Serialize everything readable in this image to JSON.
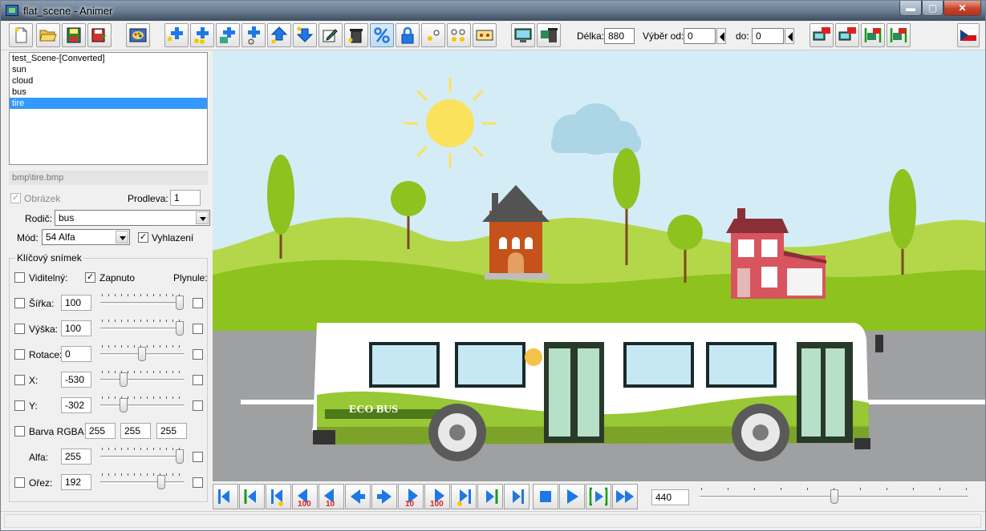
{
  "window": {
    "title": "flat_scene - Animer",
    "close_glyph": "✕",
    "min_glyph": "▬",
    "max_glyph": "▢"
  },
  "toolbar": {
    "length_label": "Délka:",
    "length_value": "880",
    "selection_from_label": "Výběr od:",
    "selection_from_value": "0",
    "selection_to_label": "do:",
    "selection_to_value": "0"
  },
  "objects": [
    "test_Scene-[Converted]",
    "sun",
    "cloud",
    "bus",
    "tire"
  ],
  "selected_object": "tire",
  "image_path": "bmp\\tire.bmp",
  "props": {
    "image_label": "Obrázek",
    "image_checked": true,
    "delay_label": "Prodleva:",
    "delay_value": "1",
    "parent_label": "Rodič:",
    "parent_value": "bus",
    "mode_label": "Mód:",
    "mode_value": "54 Alfa",
    "smoothing_label": "Vyhlazení",
    "smoothing_checked": true
  },
  "keyframe": {
    "group_label": "Klíčový snímek",
    "visible_label": "Viditelný:",
    "enabled_label": "Zapnuto",
    "enabled_checked": true,
    "smooth_label": "Plynule:",
    "width_label": "Šířka:",
    "width_value": "100",
    "width_slider": 1.0,
    "height_label": "Výška:",
    "height_value": "100",
    "height_slider": 1.0,
    "rotation_label": "Rotace:",
    "rotation_value": "0",
    "rotation_slider": 0.5,
    "x_label": "X:",
    "x_value": "-530",
    "x_slider": 0.25,
    "y_label": "Y:",
    "y_value": "-302",
    "y_slider": 0.25,
    "rgba_label": "Barva RGBA:",
    "r_value": "255",
    "g_value": "255",
    "b_value": "255",
    "alpha_label": "Alfa:",
    "alpha_value": "255",
    "alpha_slider": 1.0,
    "crop_label": "Ořez:",
    "crop_value": "192",
    "crop_slider": 0.75
  },
  "scene": {
    "bus_text": "ECO BUS"
  },
  "transport": {
    "step_back_100": "100",
    "step_back_10": "10",
    "step_fwd_10": "10",
    "step_fwd_100": "100",
    "frame_value": "440",
    "timeline_position": 0.5
  },
  "colors": {
    "sky": "#d4ecf6",
    "grass": "#8dc21f",
    "road": "#9ea0a1",
    "sun": "#fbe25d",
    "selection": "#3399ff",
    "icon_blue": "#1e78e6"
  }
}
